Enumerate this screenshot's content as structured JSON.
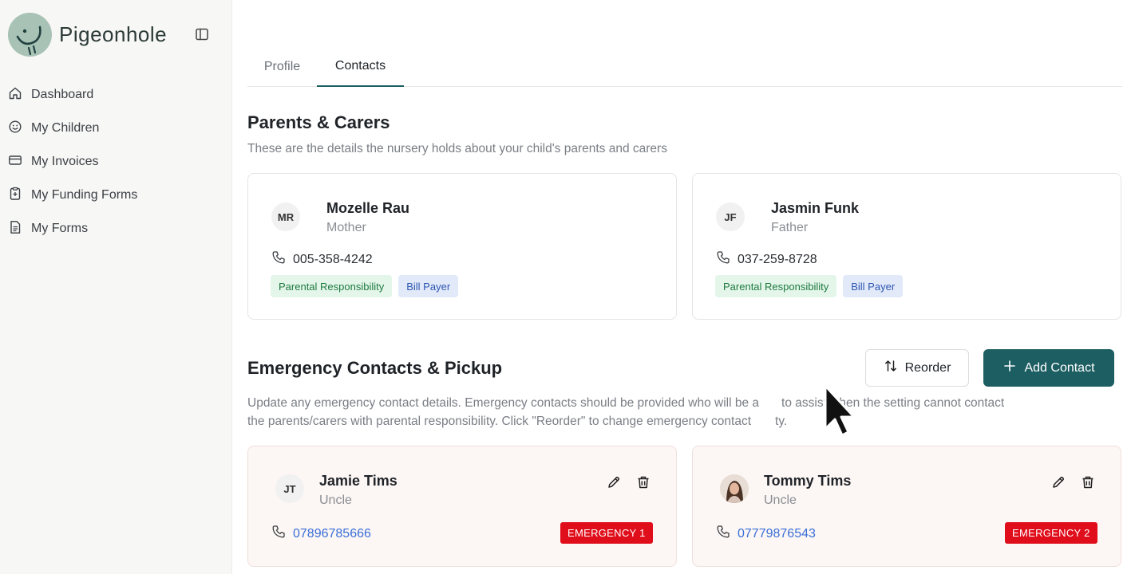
{
  "sidebar": {
    "brand": "Pigeonhole",
    "items": [
      {
        "label": "Dashboard",
        "icon": "home-icon"
      },
      {
        "label": "My Children",
        "icon": "smile-icon"
      },
      {
        "label": "My Invoices",
        "icon": "credit-card-icon"
      },
      {
        "label": "My Funding Forms",
        "icon": "clipboard-icon"
      },
      {
        "label": "My Forms",
        "icon": "document-icon"
      }
    ]
  },
  "tabs": [
    {
      "label": "Profile",
      "active": false
    },
    {
      "label": "Contacts",
      "active": true
    }
  ],
  "parents": {
    "title": "Parents & Carers",
    "description": "These are the details the nursery holds about your child's parents and carers",
    "cards": [
      {
        "initials": "MR",
        "name": "Mozelle Rau",
        "relation": "Mother",
        "phone": "005-358-4242",
        "badges": [
          "Parental Responsibility",
          "Bill Payer"
        ]
      },
      {
        "initials": "JF",
        "name": "Jasmin Funk",
        "relation": "Father",
        "phone": "037-259-8728",
        "badges": [
          "Parental Responsibility",
          "Bill Payer"
        ]
      }
    ]
  },
  "emergency": {
    "title": "Emergency Contacts & Pickup",
    "reorder_label": "Reorder",
    "add_label": "Add Contact",
    "description_line1": "Update any emergency contact details. Emergency contacts should be provided who will be a",
    "description_line1_end": "to assist when the setting cannot contact",
    "description_line2": "the parents/carers with parental responsibility. Click \"Reorder\" to change emergency contact",
    "description_line2_end": "ty.",
    "cards": [
      {
        "initials": "JT",
        "name": "Jamie Tims",
        "relation": "Uncle",
        "phone": "07896785666",
        "badge": "EMERGENCY 1"
      },
      {
        "initials": "",
        "name": "Tommy Tims",
        "relation": "Uncle",
        "phone": "07779876543",
        "badge": "EMERGENCY 2"
      }
    ]
  },
  "colors": {
    "primary": "#1d5e62",
    "emergency_red": "#e00d1b",
    "link_blue": "#3a6fd8",
    "badge_green_bg": "#e4f6ea",
    "badge_blue_bg": "#e2eafa"
  }
}
